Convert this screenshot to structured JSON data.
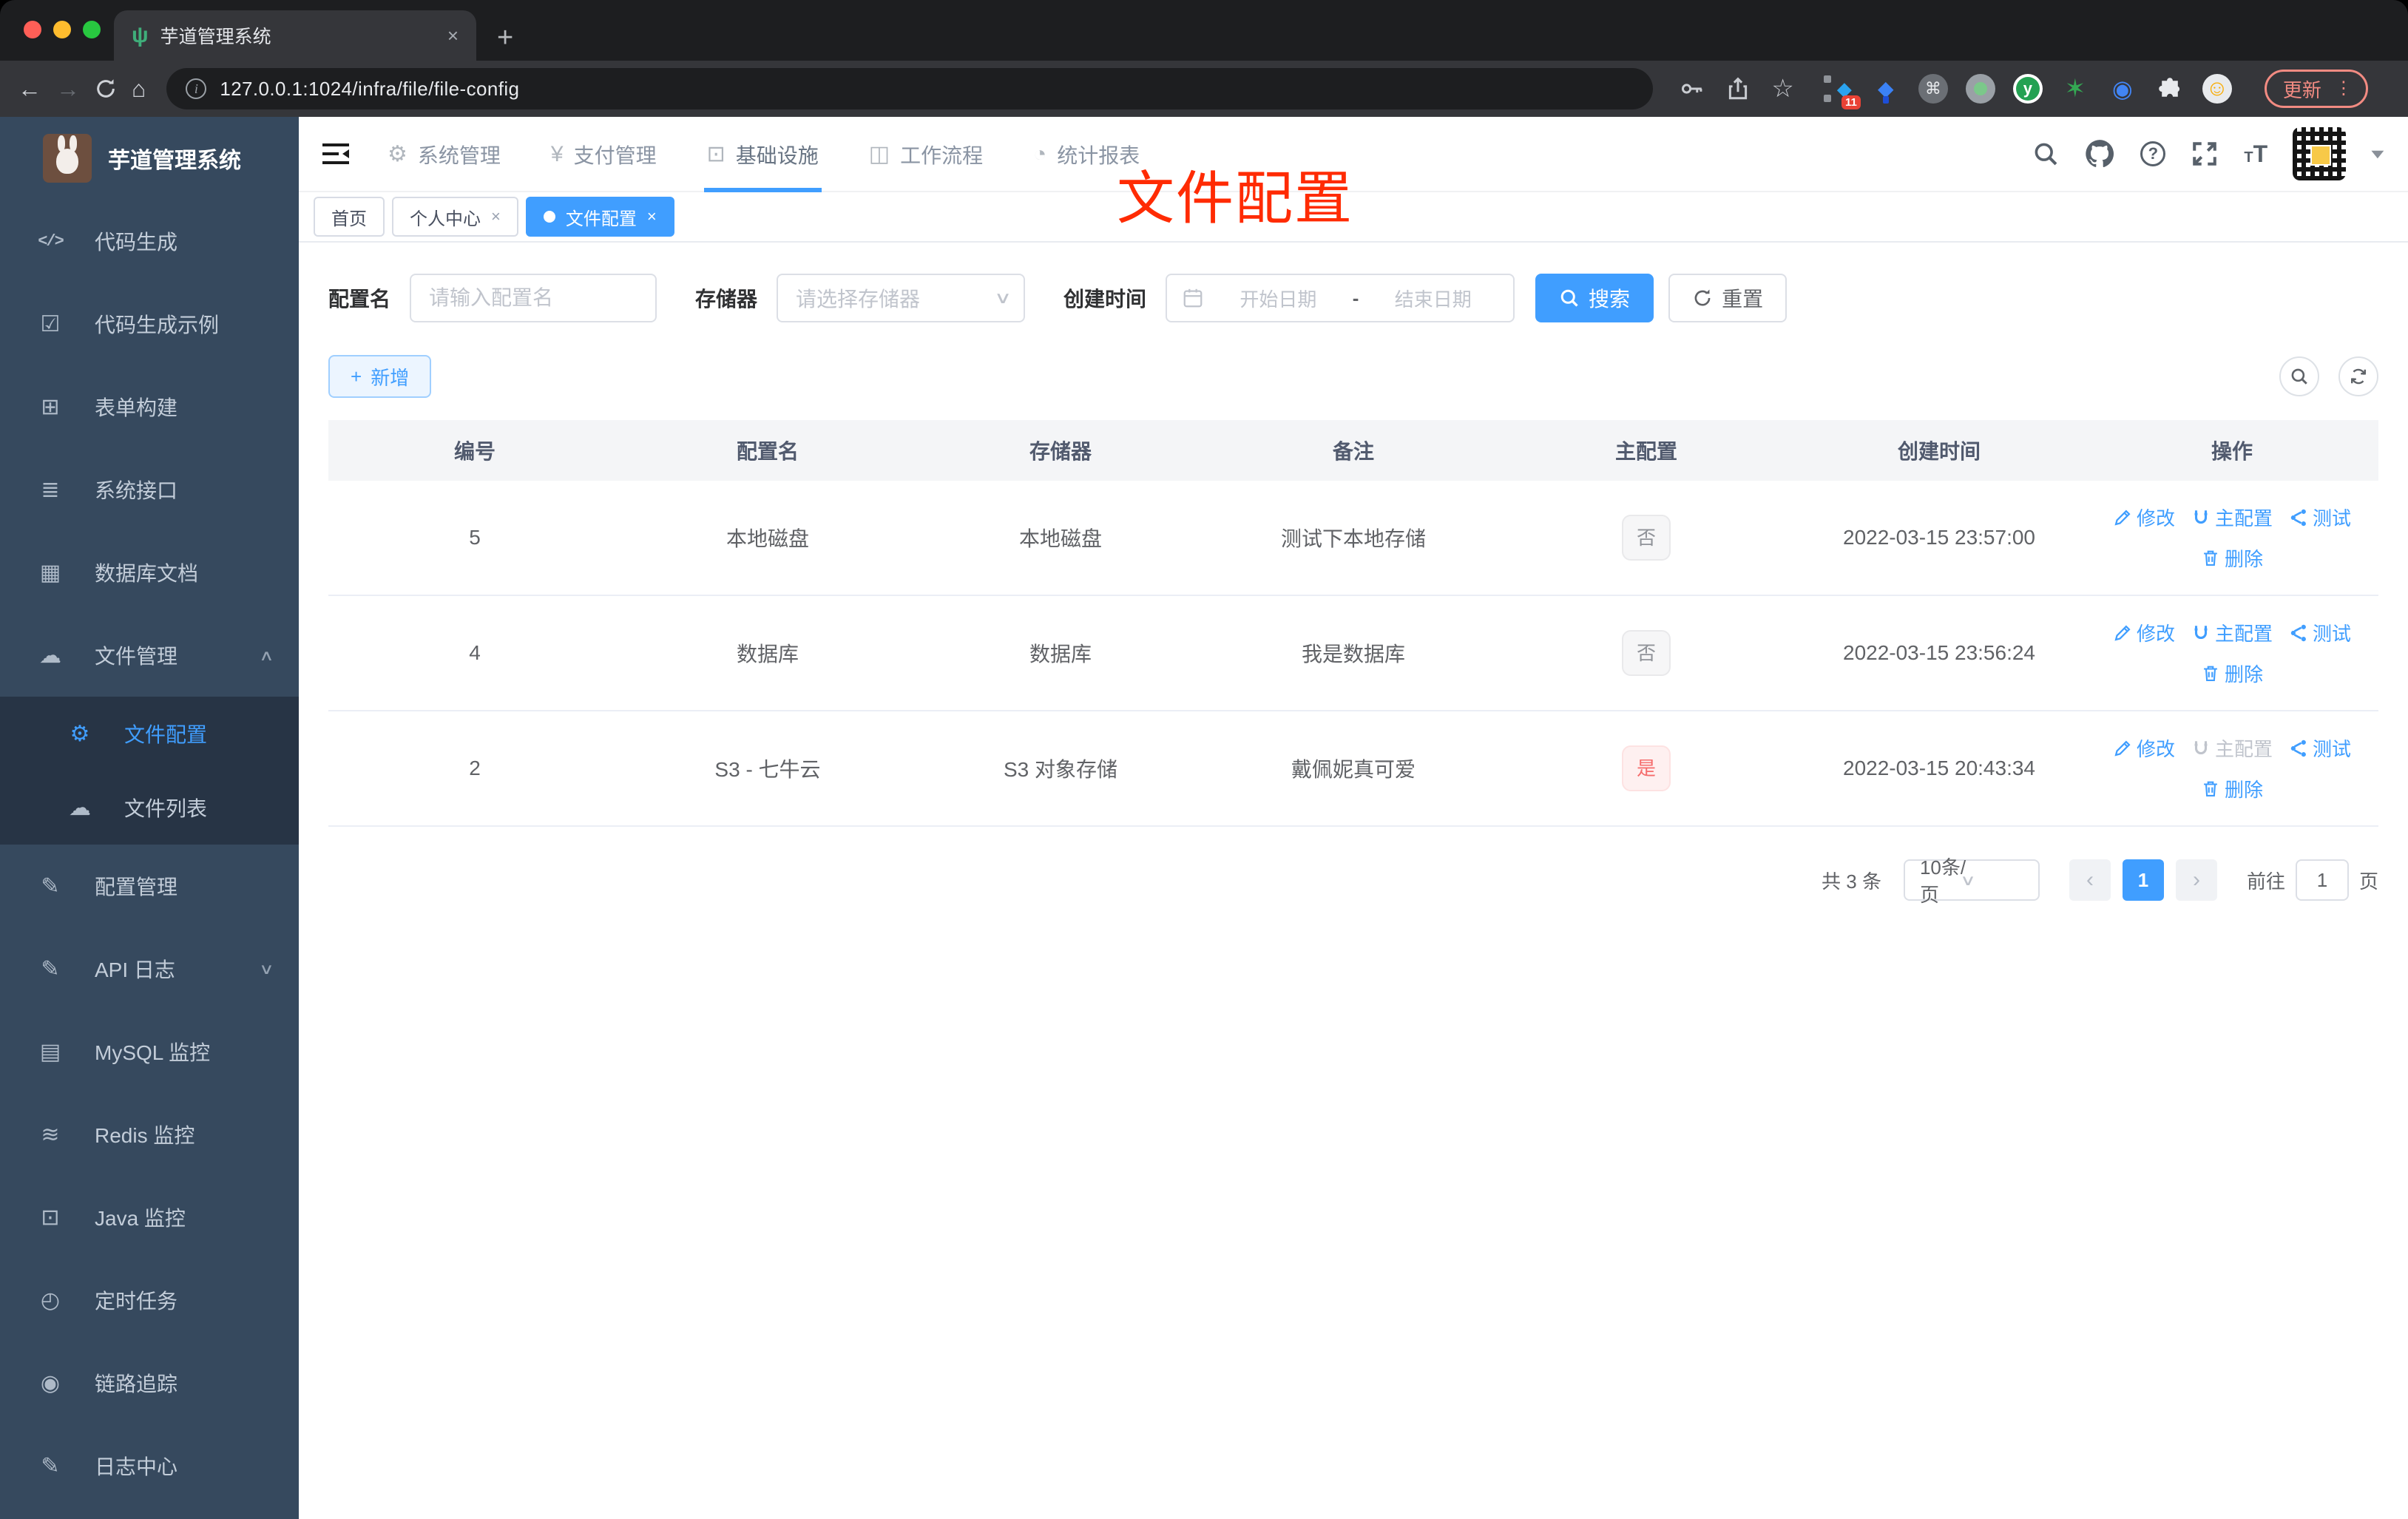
{
  "browser": {
    "tab_title": "芋道管理系统",
    "new_tab": "+",
    "close_glyph": "×",
    "url": "127.0.0.1:1024/infra/file/file-config",
    "update_label": "更新",
    "extension_badge": "11",
    "traffic_colors": {
      "red": "#ff5f57",
      "yellow": "#febc2e",
      "green": "#28c840"
    }
  },
  "sidebar": {
    "logo_title": "芋道管理系统",
    "items": [
      {
        "icon": "code-icon",
        "label": "代码生成"
      },
      {
        "icon": "shield-check-icon",
        "label": "代码生成示例"
      },
      {
        "icon": "form-grid-icon",
        "label": "表单构建"
      },
      {
        "icon": "sliders-icon",
        "label": "系统接口"
      },
      {
        "icon": "database-table-icon",
        "label": "数据库文档"
      },
      {
        "icon": "cloud-download-icon",
        "label": "文件管理",
        "chevron": "up",
        "children": [
          {
            "icon": "gear-icon",
            "label": "文件配置",
            "active": true
          },
          {
            "icon": "cloud-upload-icon",
            "label": "文件列表"
          }
        ]
      },
      {
        "icon": "edit-square-icon",
        "label": "配置管理"
      },
      {
        "icon": "log-edit-icon",
        "label": "API 日志",
        "chevron": "down"
      },
      {
        "icon": "mysql-monitor-icon",
        "label": "MySQL 监控"
      },
      {
        "icon": "redis-layers-icon",
        "label": "Redis 监控"
      },
      {
        "icon": "java-monitor-icon",
        "label": "Java 监控"
      },
      {
        "icon": "timer-icon",
        "label": "定时任务"
      },
      {
        "icon": "trace-eye-icon",
        "label": "链路追踪"
      },
      {
        "icon": "log-center-icon",
        "label": "日志中心"
      }
    ]
  },
  "topnav": {
    "items": [
      {
        "icon": "gear-icon",
        "label": "系统管理"
      },
      {
        "icon": "yen-icon",
        "label": "支付管理"
      },
      {
        "icon": "monitor-icon",
        "label": "基础设施",
        "active": true
      },
      {
        "icon": "briefcase-icon",
        "label": "工作流程"
      },
      {
        "icon": "dashboard-icon",
        "label": "统计报表"
      }
    ]
  },
  "tags_bar": {
    "tabs": [
      {
        "label": "首页"
      },
      {
        "label": "个人中心",
        "closable": true
      },
      {
        "label": "文件配置",
        "closable": true,
        "active": true
      }
    ]
  },
  "annotation_text": "文件配置",
  "filters": {
    "name_label": "配置名",
    "name_placeholder": "请输入配置名",
    "storage_label": "存储器",
    "storage_placeholder": "请选择存储器",
    "date_label": "创建时间",
    "date_start_placeholder": "开始日期",
    "date_separator": "-",
    "date_end_placeholder": "结束日期",
    "search_label": "搜索",
    "reset_label": "重置"
  },
  "list_toolbar": {
    "add_label": "新增",
    "add_plus": "+"
  },
  "table": {
    "columns": [
      "编号",
      "配置名",
      "存储器",
      "备注",
      "主配置",
      "创建时间",
      "操作"
    ],
    "action_labels": {
      "edit": "修改",
      "master": "主配置",
      "test": "测试",
      "delete": "删除"
    },
    "rows": [
      {
        "id": "5",
        "name": "本地磁盘",
        "storage": "本地磁盘",
        "remark": "测试下本地存储",
        "master": "否",
        "master_type": "gray",
        "created": "2022-03-15 23:57:00",
        "master_disabled": false
      },
      {
        "id": "4",
        "name": "数据库",
        "storage": "数据库",
        "remark": "我是数据库",
        "master": "否",
        "master_type": "gray",
        "created": "2022-03-15 23:56:24",
        "master_disabled": false
      },
      {
        "id": "2",
        "name": "S3 - 七牛云",
        "storage": "S3 对象存储",
        "remark": "戴佩妮真可爱",
        "master": "是",
        "master_type": "red",
        "created": "2022-03-15 20:43:34",
        "master_disabled": true
      }
    ]
  },
  "pagination": {
    "total": "共 3 条",
    "page_size": "10条/页",
    "prev_glyph": "‹",
    "next_glyph": "›",
    "current_page": "1",
    "goto_label": "前往",
    "goto_value": "1",
    "page_suffix": "页"
  },
  "colors": {
    "accent": "#409eff",
    "annotation": "#ff2b03",
    "sidebar_bg": "#36495e",
    "submenu_bg": "#273445"
  }
}
